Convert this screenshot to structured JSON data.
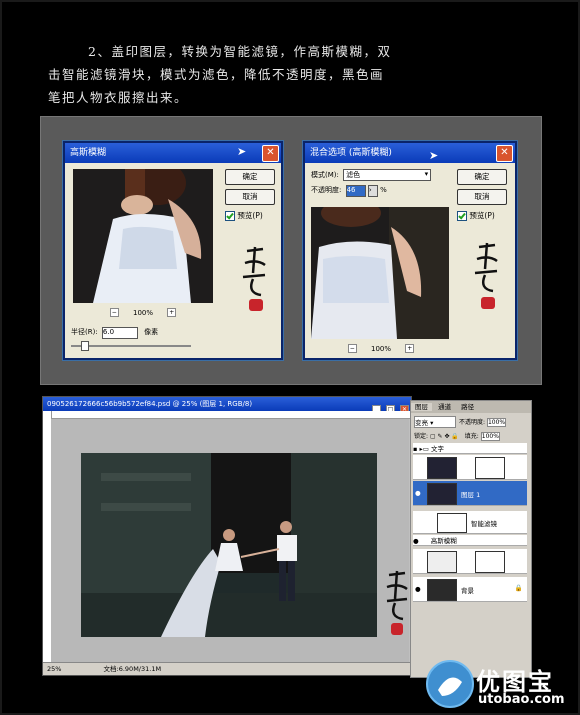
{
  "intro": {
    "line1": "2、盖印图层，转换为智能滤镜，作高斯模糊，双",
    "line2": "击智能滤镜滑块，模式为滤色，降低不透明度，黑色画",
    "line3": "笔把人物衣服擦出来。"
  },
  "gaussian": {
    "title": "高斯模糊",
    "ok": "确定",
    "reset": "取消",
    "preview": "预览(P)",
    "zoom": "100%",
    "radius_label": "半径(R):",
    "radius_value": "6.0",
    "unit": "像素"
  },
  "blend": {
    "title": "混合选项 (高斯模糊)",
    "mode_label": "模式(M):",
    "mode_value": "滤色",
    "opacity_label": "不透明度:",
    "opacity_value": "46",
    "percent": "%",
    "ok": "确定",
    "reset": "取消",
    "preview": "预览(P)",
    "zoom": "100%"
  },
  "ps": {
    "doc_title": "090526172666c56b9b572ef84.psd @ 25% (图层 1, RGB/8)",
    "zoom": "25%",
    "status": "文档:6.90M/31.1M"
  },
  "layers": {
    "tabs": [
      "图层",
      "通道",
      "路径"
    ],
    "mode": "变亮",
    "opacity_label": "不透明度:",
    "opacity_value": "100%",
    "lock_label": "锁定:",
    "fill_label": "填充:",
    "fill_value": "100%",
    "group": "文字",
    "layer1": "图层 1",
    "smart_filters": "智能滤镜",
    "gaussian": "高斯模糊",
    "background": "背景"
  },
  "watermark": {
    "brand": "优图宝",
    "url": "utobao.com"
  },
  "colors": {
    "accent": "#0a3bb8",
    "seal": "#c8242b"
  }
}
